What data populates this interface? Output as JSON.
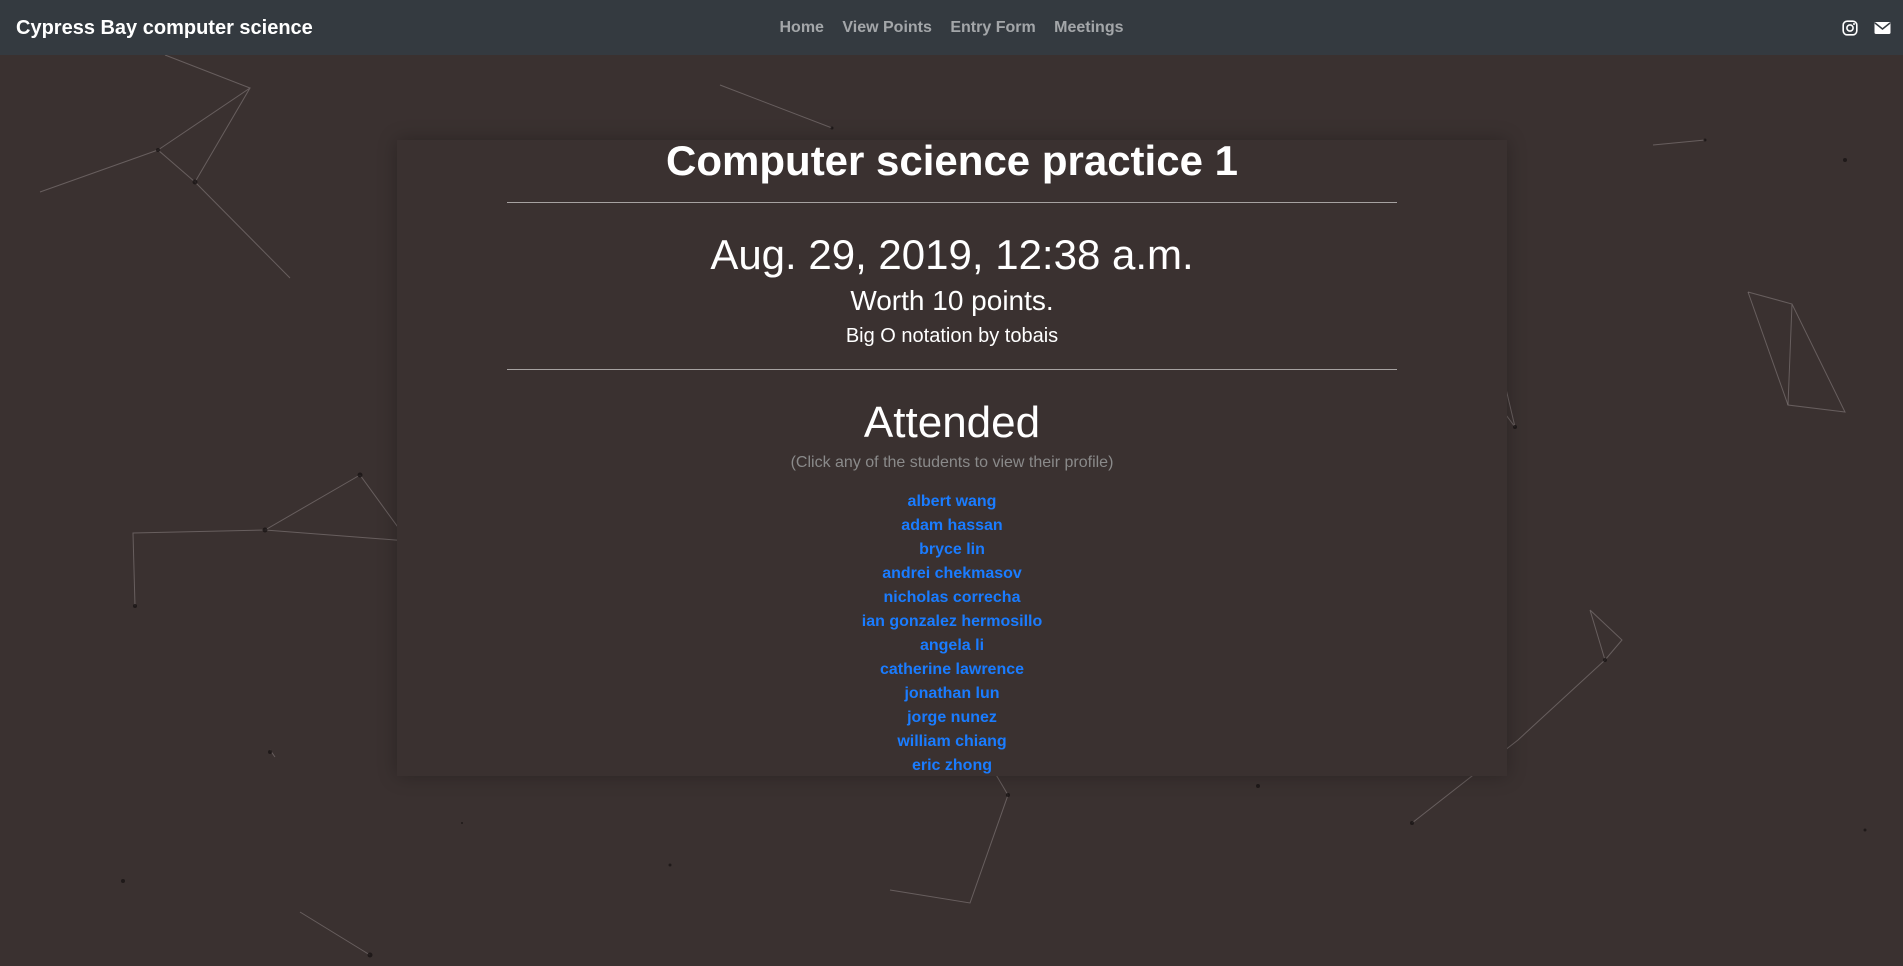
{
  "navbar": {
    "brand": "Cypress Bay computer science",
    "links": [
      "Home",
      "View Points",
      "Entry Form",
      "Meetings"
    ],
    "icons": [
      "instagram-icon",
      "mail-icon"
    ]
  },
  "meeting": {
    "title": "Computer science practice 1",
    "date": "Aug. 29, 2019, 12:38 a.m.",
    "worth": "Worth 10 points.",
    "description": "Big O notation by tobais",
    "attended_heading": "Attended",
    "hint": "(Click any of the students to view their profile)",
    "students": [
      "albert wang",
      "adam hassan",
      "bryce lin",
      "andrei chekmasov",
      "nicholas correcha",
      "ian gonzalez hermosillo",
      "angela li",
      "catherine lawrence",
      "jonathan lun",
      "jorge nunez",
      "william chiang",
      "eric zhong"
    ]
  },
  "colors": {
    "background": "#3a3130",
    "navbar": "#343a40",
    "link": "#1a7cff"
  }
}
